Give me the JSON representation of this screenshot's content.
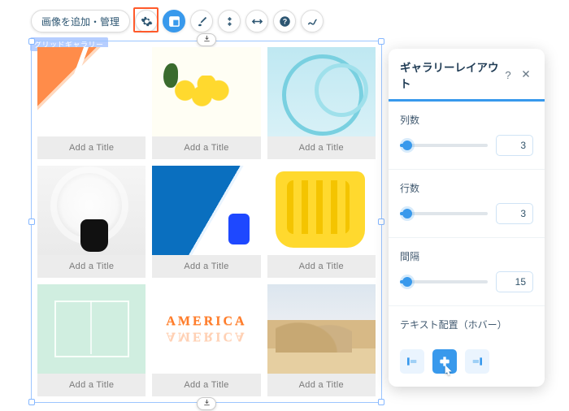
{
  "toolbar": {
    "manage_button": "画像を追加・管理",
    "icons": {
      "settings": "gear-icon",
      "layout": "layout-icon",
      "design": "brush-icon",
      "animation": "diamond-icon",
      "stretch": "arrows-h-icon",
      "help": "help-icon",
      "path": "path-icon"
    }
  },
  "gallery": {
    "component_tag": "グリッドギャラリー",
    "items": [
      {
        "id": "img1",
        "caption": "Add a Title"
      },
      {
        "id": "img2",
        "caption": "Add a Title"
      },
      {
        "id": "img3",
        "caption": "Add a Title"
      },
      {
        "id": "img4",
        "caption": "Add a Title"
      },
      {
        "id": "img5",
        "caption": "Add a Title"
      },
      {
        "id": "img6",
        "caption": "Add a Title"
      },
      {
        "id": "img7",
        "caption": "Add a Title"
      },
      {
        "id": "img8",
        "caption": "Add a Title",
        "overlay_text": "AMERICA"
      },
      {
        "id": "img9",
        "caption": "Add a Title"
      }
    ]
  },
  "panel": {
    "title": "ギャラリーレイアウト",
    "help": "?",
    "close": "✕",
    "fields": {
      "columns": {
        "label": "列数",
        "value": 3
      },
      "rows": {
        "label": "行数",
        "value": 3
      },
      "spacing": {
        "label": "間隔",
        "value": 15
      }
    },
    "text_align": {
      "label": "テキスト配置（ホバー）",
      "options": [
        "align-left",
        "align-center",
        "align-right"
      ],
      "selected": "align-center"
    }
  }
}
